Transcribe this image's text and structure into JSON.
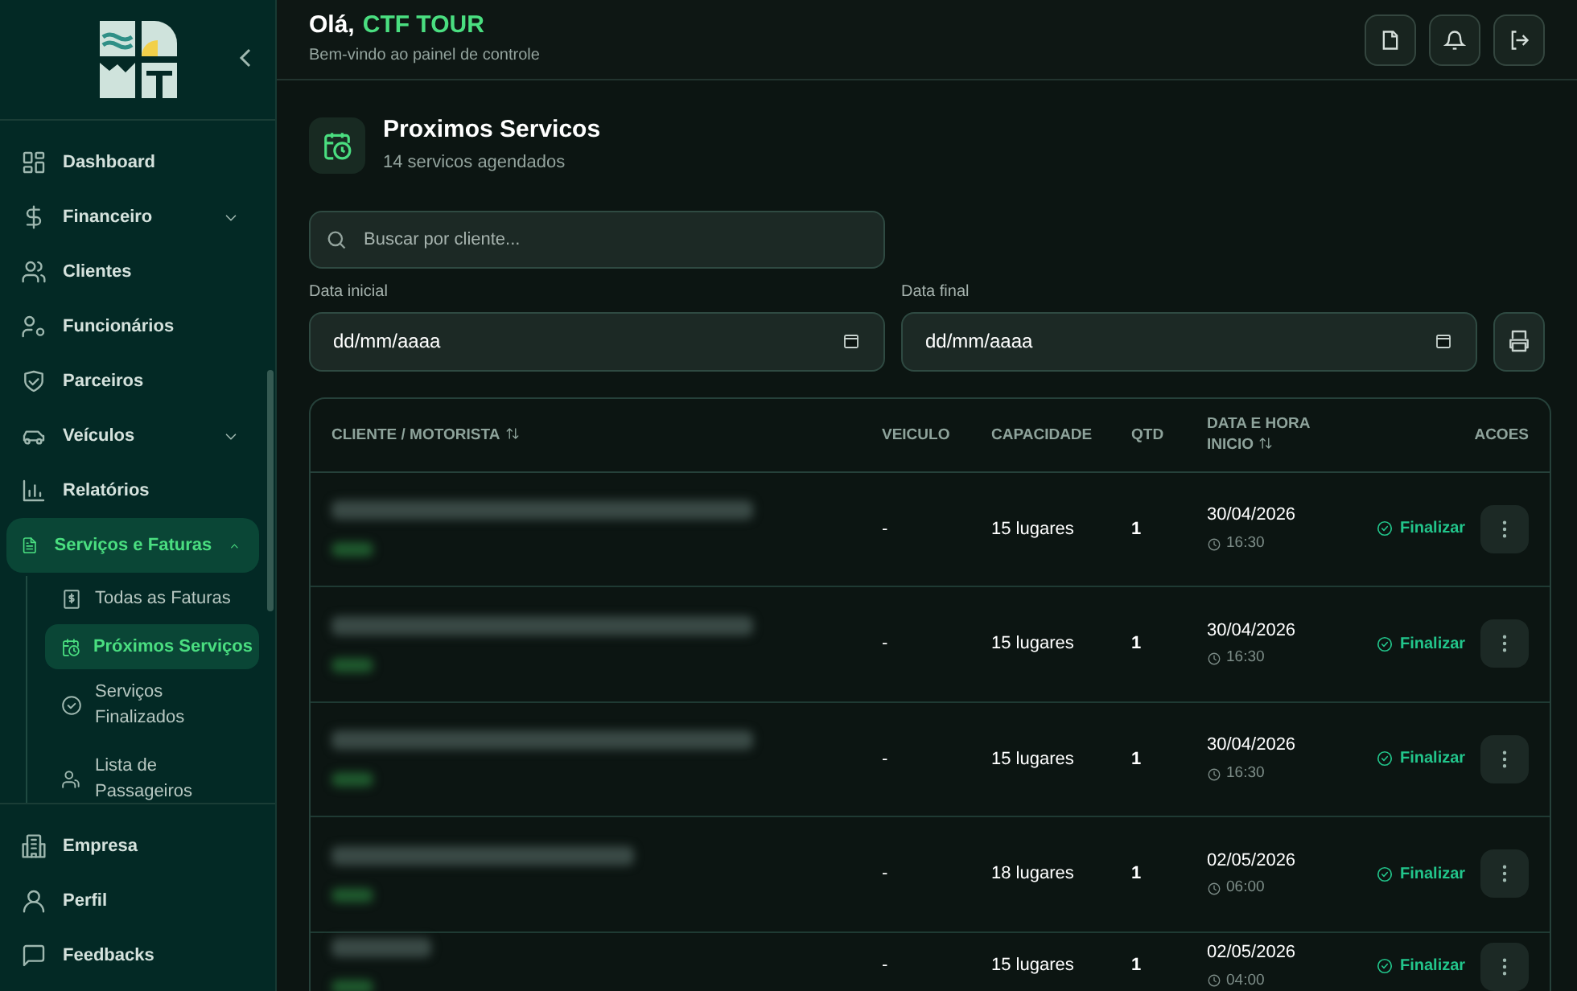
{
  "header": {
    "greeting": "Olá,",
    "company": "CTF TOUR",
    "subtitle": "Bem-vindo ao painel de controle"
  },
  "sidebar": {
    "items": [
      {
        "label": "Dashboard",
        "selected": false
      },
      {
        "label": "Financeiro",
        "selected": false,
        "expanded": false
      },
      {
        "label": "Clientes",
        "selected": false
      },
      {
        "label": "Funcionários",
        "selected": false
      },
      {
        "label": "Parceiros",
        "selected": false
      },
      {
        "label": "Veículos",
        "selected": false,
        "expanded": false
      },
      {
        "label": "Relatórios",
        "selected": false
      },
      {
        "label": "Serviços e Faturas",
        "selected": true,
        "expanded": true,
        "children": [
          {
            "label": "Todas as Faturas",
            "selected": false
          },
          {
            "label": "Próximos Serviços",
            "selected": true
          },
          {
            "label": "Serviços Finalizados",
            "selected": false
          },
          {
            "label": "Lista de Passageiros",
            "selected": false
          }
        ]
      }
    ],
    "footer_items": [
      {
        "label": "Empresa"
      },
      {
        "label": "Perfil"
      },
      {
        "label": "Feedbacks"
      }
    ]
  },
  "page": {
    "title": "Proximos Servicos",
    "subtitle": "14 servicos agendados",
    "search": {
      "placeholder": "Buscar por cliente..."
    },
    "date_fields": [
      {
        "label": "Data inicial",
        "value": "dd/mm/aaaa"
      },
      {
        "label": "Data final",
        "value": "dd/mm/aaaa"
      }
    ]
  },
  "table": {
    "columns": [
      {
        "label": "CLIENTE / MOTORISTA",
        "sortable": true
      },
      {
        "label": "VEICULO",
        "sortable": false
      },
      {
        "label": "CAPACIDADE",
        "sortable": false
      },
      {
        "label": "QTD",
        "sortable": false
      },
      {
        "label": "DATA E HORA INICIO",
        "sortable": true
      },
      {
        "label": "ACOES",
        "sortable": false
      }
    ],
    "rows": [
      {
        "vehicle": "-",
        "capacity": "15 lugares",
        "qty": "1",
        "date": "30/04/2026",
        "time": "16:30",
        "action": "Finalizar"
      },
      {
        "vehicle": "-",
        "capacity": "15 lugares",
        "qty": "1",
        "date": "30/04/2026",
        "time": "16:30",
        "action": "Finalizar"
      },
      {
        "vehicle": "-",
        "capacity": "15 lugares",
        "qty": "1",
        "date": "30/04/2026",
        "time": "16:30",
        "action": "Finalizar"
      },
      {
        "vehicle": "-",
        "capacity": "18 lugares",
        "qty": "1",
        "date": "02/05/2026",
        "time": "06:00",
        "action": "Finalizar"
      },
      {
        "vehicle": "-",
        "capacity": "15 lugares",
        "qty": "1",
        "date": "02/05/2026",
        "time": "04:00",
        "action": "Finalizar"
      }
    ]
  }
}
